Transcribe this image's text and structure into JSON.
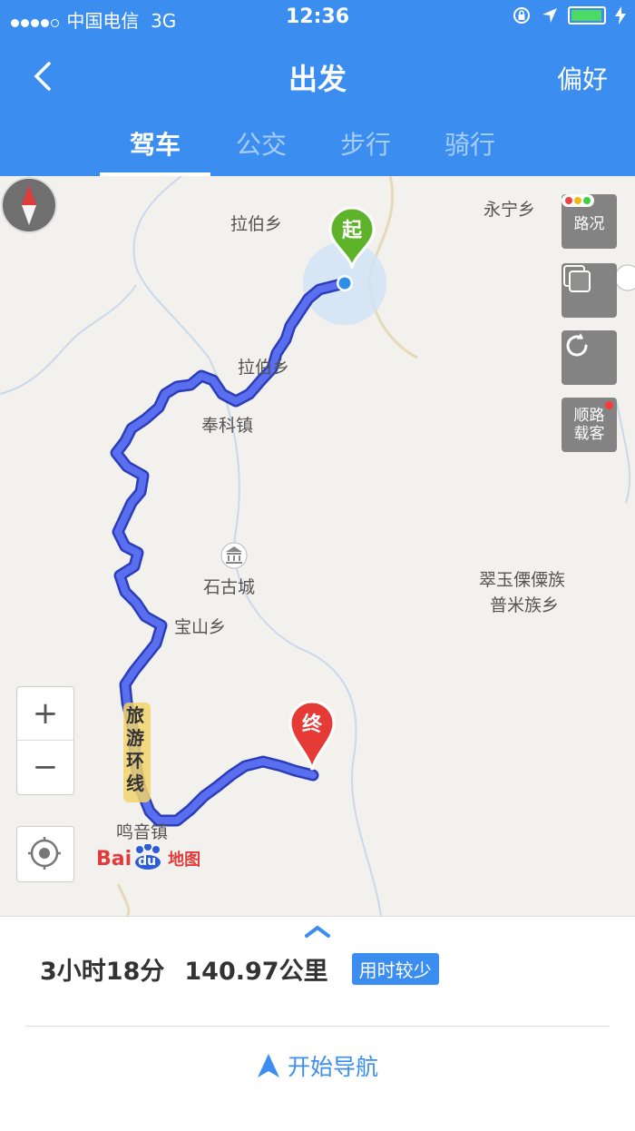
{
  "status_bar": {
    "carrier": "中国电信",
    "network": "3G",
    "time": "12:36"
  },
  "header": {
    "title": "出发",
    "preference": "偏好"
  },
  "tabs": [
    {
      "label": "驾车",
      "active": true
    },
    {
      "label": "公交",
      "active": false
    },
    {
      "label": "步行",
      "active": false
    },
    {
      "label": "骑行",
      "active": false
    }
  ],
  "map": {
    "place_labels": {
      "labo_1": "拉伯乡",
      "yongning": "永宁乡",
      "labo_2": "拉伯乡",
      "fengke": "奉科镇",
      "shigucheng": "石古城",
      "cuiyu_1": "翠玉傈僳族",
      "cuiyu_2": "普米族乡",
      "baoshan": "宝山乡",
      "mingyin": "鸣音镇",
      "tourism_road": "旅游环线"
    },
    "start_marker": "起",
    "end_marker": "终",
    "controls": {
      "traffic": "路况",
      "ride_share_1": "顺路",
      "ride_share_2": "载客"
    },
    "zoom_in": "+",
    "zoom_out": "−",
    "logo_bai": "Bai",
    "logo_du": "du",
    "logo_text": "地图",
    "route_color": "#4b5fe0"
  },
  "route_summary": {
    "duration": "3小时18分",
    "distance": "140.97公里",
    "tag": "用时较少"
  },
  "start_navigation": "开始导航",
  "colors": {
    "accent": "#3b8ef0"
  }
}
